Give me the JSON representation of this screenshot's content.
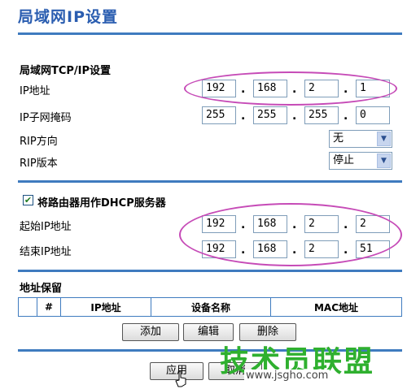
{
  "page_title": "局域网IP设置",
  "lan_section": {
    "title": "局域网TCP/IP设置",
    "ip_address": {
      "label": "IP地址",
      "octets": [
        "192",
        "168",
        "2",
        "1"
      ]
    },
    "subnet_mask": {
      "label": "IP子网掩码",
      "octets": [
        "255",
        "255",
        "255",
        "0"
      ]
    },
    "rip_direction": {
      "label": "RIP方向",
      "value": "无"
    },
    "rip_version": {
      "label": "RIP版本",
      "value": "停止"
    }
  },
  "dhcp_section": {
    "checkbox_label": "将路由器用作DHCP服务器",
    "checked": true,
    "start_ip": {
      "label": "起始IP地址",
      "octets": [
        "192",
        "168",
        "2",
        "2"
      ]
    },
    "end_ip": {
      "label": "结束IP地址",
      "octets": [
        "192",
        "168",
        "2",
        "51"
      ]
    }
  },
  "reservation_section": {
    "title": "地址保留",
    "columns": [
      "",
      "#",
      "IP地址",
      "设备名称",
      "MAC地址"
    ],
    "buttons": {
      "add": "添加",
      "edit": "编辑",
      "delete": "删除"
    }
  },
  "footer_buttons": {
    "apply": "应用",
    "cancel": "取消"
  },
  "watermark": {
    "text": "技术员联盟",
    "url": "www.jsgho.com"
  },
  "colors": {
    "accent": "#3f7bbf",
    "title": "#2a5db0",
    "highlight": "#c64bb7",
    "watermark": "#2fb02f"
  }
}
